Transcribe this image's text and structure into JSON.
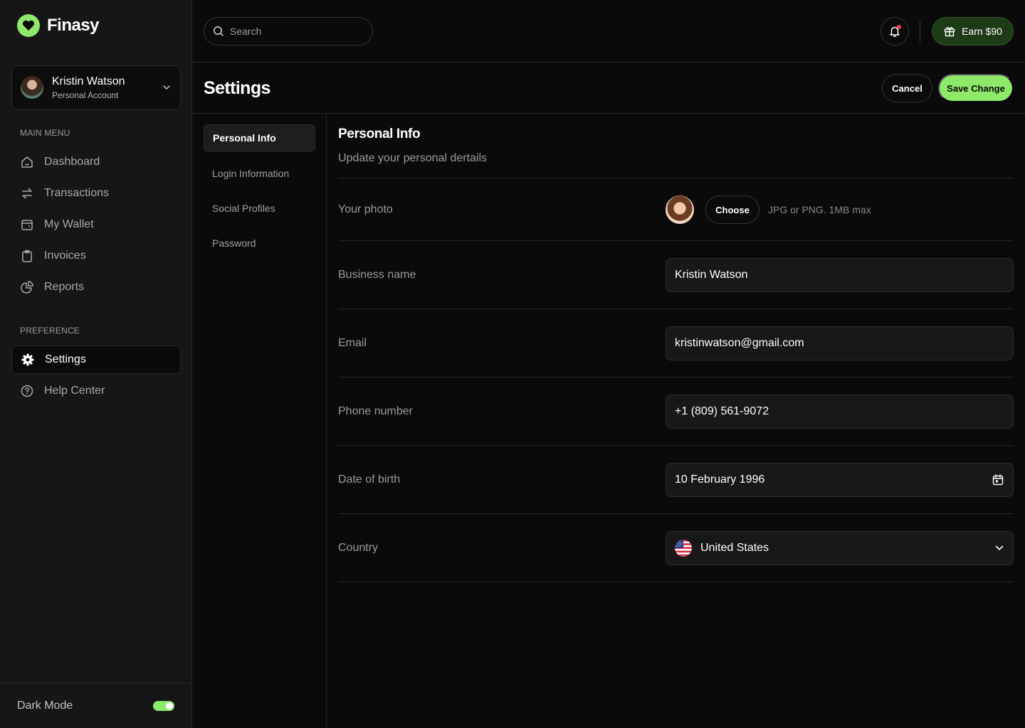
{
  "app": {
    "name": "Finasy"
  },
  "account": {
    "name": "Kristin Watson",
    "type": "Personal Account"
  },
  "sidebar": {
    "main_menu_title": "MAIN MENU",
    "main_items": [
      {
        "label": "Dashboard",
        "icon": "home-icon"
      },
      {
        "label": "Transactions",
        "icon": "transfer-arrows-icon"
      },
      {
        "label": "My Wallet",
        "icon": "wallet-icon"
      },
      {
        "label": "Invoices",
        "icon": "clipboard-icon"
      },
      {
        "label": "Reports",
        "icon": "pie-chart-icon"
      }
    ],
    "preference_title": "PREFERENCE",
    "preference_items": [
      {
        "label": "Settings",
        "icon": "gear-icon",
        "active": true
      },
      {
        "label": "Help Center",
        "icon": "help-circle-icon"
      }
    ],
    "dark_mode_label": "Dark Mode",
    "dark_mode_on": true
  },
  "topbar": {
    "search_placeholder": "Search",
    "earn_label": "Earn $90"
  },
  "header": {
    "title": "Settings",
    "cancel_label": "Cancel",
    "save_label": "Save Change"
  },
  "subnav": [
    {
      "label": "Personal Info",
      "active": true
    },
    {
      "label": "Login Information"
    },
    {
      "label": "Social Profiles"
    },
    {
      "label": "Password"
    }
  ],
  "form": {
    "title": "Personal Info",
    "subtitle": "Update your personal dertails",
    "photo": {
      "label": "Your photo",
      "choose_label": "Choose",
      "hint": "JPG or PNG. 1MB max"
    },
    "business_name": {
      "label": "Business name",
      "value": "Kristin Watson"
    },
    "email": {
      "label": "Email",
      "value": "kristinwatson@gmail.com"
    },
    "phone": {
      "label": "Phone number",
      "value": "+1 (809) 561-9072"
    },
    "dob": {
      "label": "Date of birth",
      "value": "10 February 1996"
    },
    "country": {
      "label": "Country",
      "value": "United States"
    }
  },
  "colors": {
    "accent": "#8ee86a",
    "background": "#0a0a0a",
    "sidebar": "#161616",
    "notification": "#ff3b5c"
  }
}
